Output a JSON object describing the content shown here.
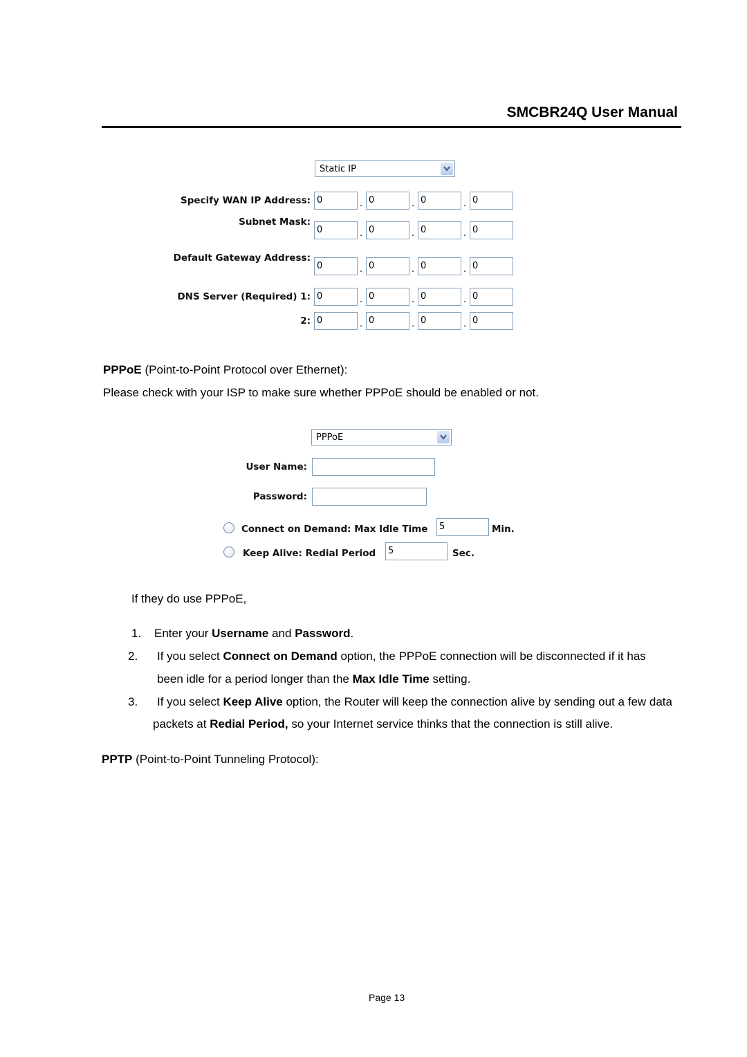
{
  "header": {
    "title": "SMCBR24Q User Manual"
  },
  "static_ip_form": {
    "connection_type": "Static IP",
    "rows": [
      {
        "label": "Specify WAN IP Address:",
        "octets": [
          "0",
          "0",
          "0",
          "0"
        ]
      },
      {
        "label": "Subnet Mask:",
        "octets": [
          "0",
          "0",
          "0",
          "0"
        ]
      },
      {
        "label": "Default Gateway Address:",
        "octets": [
          "0",
          "0",
          "0",
          "0"
        ]
      },
      {
        "label": "DNS Server (Required) 1:",
        "octets": [
          "0",
          "0",
          "0",
          "0"
        ]
      },
      {
        "label": "2:",
        "octets": [
          "0",
          "0",
          "0",
          "0"
        ]
      }
    ],
    "separator": "."
  },
  "pppoe_section": {
    "heading_bold": "PPPoE",
    "heading_rest": " (Point-to-Point Protocol over Ethernet):",
    "note": "Please check with your ISP to make sure whether PPPoE should be enabled or not."
  },
  "pppoe_form": {
    "connection_type": "PPPoE",
    "user_name_label": "User Name:",
    "user_name_value": "",
    "password_label": "Password:",
    "password_value": "",
    "connect_on_demand_label": "Connect on Demand: Max Idle Time",
    "max_idle_time": "5",
    "max_idle_unit": "Min.",
    "keep_alive_label": "Keep Alive: Redial Period",
    "redial_period": "5",
    "redial_unit": "Sec."
  },
  "instructions": {
    "intro": "If they do use PPPoE,",
    "steps": [
      {
        "num": "1.",
        "parts": [
          {
            "t": "Enter your ",
            "b": false
          },
          {
            "t": "Username",
            "b": true
          },
          {
            "t": " and ",
            "b": false
          },
          {
            "t": "Password",
            "b": true
          },
          {
            "t": ".",
            "b": false
          }
        ]
      },
      {
        "num": "2.",
        "line1": [
          {
            "t": "If you select ",
            "b": false
          },
          {
            "t": "Connect on Demand",
            "b": true
          },
          {
            "t": " option, the PPPoE connection will be disconnected if it has",
            "b": false
          }
        ],
        "line2": [
          {
            "t": "been idle for a period longer than the ",
            "b": false
          },
          {
            "t": "Max Idle Time",
            "b": true
          },
          {
            "t": " setting.",
            "b": false
          }
        ]
      },
      {
        "num": "3.",
        "line1": [
          {
            "t": "If you select ",
            "b": false
          },
          {
            "t": "Keep Alive",
            "b": true
          },
          {
            "t": " option, the Router will keep the connection alive by sending out a few data",
            "b": false
          }
        ],
        "line2": [
          {
            "t": "packets at ",
            "b": false
          },
          {
            "t": "Redial Period,",
            "b": true
          },
          {
            "t": " so your Internet service thinks that the connection is still alive.",
            "b": false
          }
        ]
      }
    ]
  },
  "pptp_section": {
    "heading_bold": "PPTP",
    "heading_rest": " (Point-to-Point Tunneling Protocol):"
  },
  "footer": {
    "page": "Page 13"
  }
}
